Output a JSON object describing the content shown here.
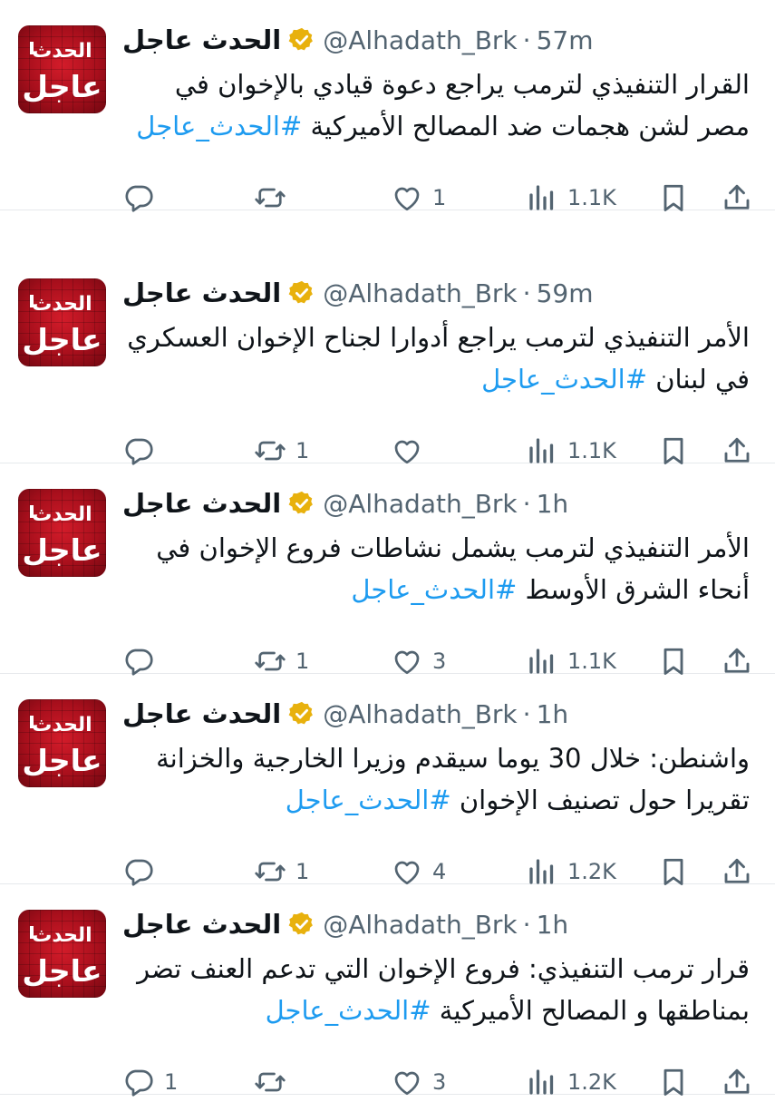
{
  "account": {
    "name": "الحدث عاجل",
    "handle": "@Alhadath_Brk",
    "avatar_line1": "الحدث",
    "avatar_line2": "عاجل"
  },
  "tweets": [
    {
      "time": "57m",
      "text": "القرار التنفيذي لترمب يراجع دعوة قيادي بالإخوان في مصر لشن هجمات ضد المصالح الأميركية",
      "hashtag": "#الحدث_عاجل",
      "replies": "",
      "retweets": "",
      "likes": "1",
      "views": "1.1K"
    },
    {
      "time": "59m",
      "text": "الأمر التنفيذي لترمب يراجع أدوارا لجناح الإخوان العسكري في لبنان",
      "hashtag": "#الحدث_عاجل",
      "replies": "",
      "retweets": "1",
      "likes": "",
      "views": "1.1K"
    },
    {
      "time": "1h",
      "text": "الأمر التنفيذي لترمب يشمل نشاطات فروع الإخوان في أنحاء الشرق الأوسط",
      "hashtag": "#الحدث_عاجل",
      "replies": "",
      "retweets": "1",
      "likes": "3",
      "views": "1.1K"
    },
    {
      "time": "1h",
      "text": "واشنطن: خلال 30 يوما سيقدم وزيرا الخارجية والخزانة تقريرا حول تصنيف الإخوان",
      "hashtag": "#الحدث_عاجل",
      "replies": "",
      "retweets": "1",
      "likes": "4",
      "views": "1.2K"
    },
    {
      "time": "1h",
      "text": "قرار ترمب التنفيذي: فروع الإخوان التي تدعم العنف تضر بمناطقها و المصالح الأميركية",
      "hashtag": "#الحدث_عاجل",
      "replies": "1",
      "retweets": "",
      "likes": "3",
      "views": "1.2K"
    }
  ],
  "colors": {
    "hashtag": "#1d9bf0",
    "verified": "#e8b10d",
    "muted": "#536471",
    "avatar": "#c0141f"
  },
  "icons": [
    "verified-badge-icon",
    "reply-icon",
    "retweet-icon",
    "like-icon",
    "views-icon",
    "bookmark-icon",
    "share-icon"
  ]
}
